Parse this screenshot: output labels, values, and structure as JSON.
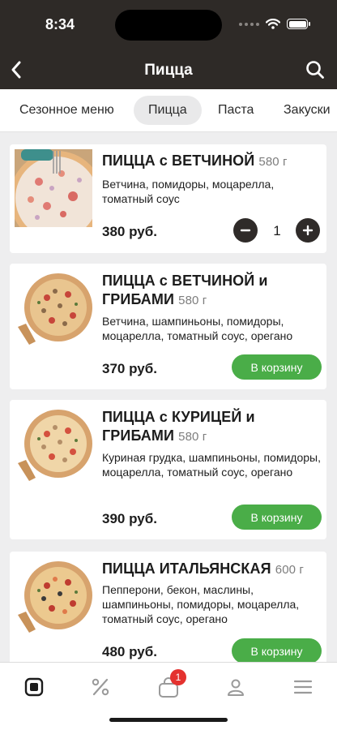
{
  "status": {
    "time": "8:34"
  },
  "header": {
    "title": "Пицца",
    "back_icon": "chevron-left-icon",
    "search_icon": "search-icon"
  },
  "tabs": [
    {
      "label": "Сезонное меню",
      "active": false
    },
    {
      "label": "Пицца",
      "active": true
    },
    {
      "label": "Паста",
      "active": false
    },
    {
      "label": "Закуски",
      "active": false
    }
  ],
  "products": [
    {
      "name": "ПИЦЦА с ВЕТЧИНОЙ",
      "weight": "580 г",
      "description": "Ветчина, помидоры, моцарелла, томатный соус",
      "price": "380 руб.",
      "quantity": "1"
    },
    {
      "name": "ПИЦЦА с ВЕТЧИНОЙ и ГРИБАМИ",
      "weight": "580 г",
      "description": "Ветчина, шампиньоны, помидоры, моцарелла, томатный соус, орегано",
      "price": "370 руб.",
      "button": "В корзину"
    },
    {
      "name": "ПИЦЦА с КУРИЦЕЙ и ГРИБАМИ",
      "weight": "580 г",
      "description": "Куриная грудка, шампиньоны, помидоры, моцарелла, томатный соус, орегано",
      "price": "390 руб.",
      "button": "В корзину"
    },
    {
      "name": "ПИЦЦА ИТАЛЬЯНСКАЯ",
      "weight": "600 г",
      "description": "Пепперони, бекон, маслины, шампиньоны, помидоры, моцарелла, томатный соус, орегано",
      "price": "480 руб.",
      "button": "В корзину"
    }
  ],
  "tabbar": {
    "items": [
      "menu-icon",
      "discount-icon",
      "cart-icon",
      "profile-icon",
      "hamburger-icon"
    ],
    "cart_badge": "1"
  },
  "colors": {
    "header": "#2e2a27",
    "accent_green": "#4aad48",
    "badge_red": "#e4322f"
  }
}
